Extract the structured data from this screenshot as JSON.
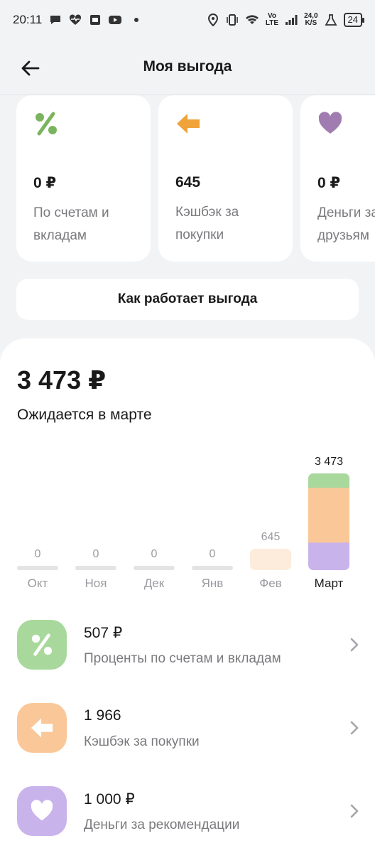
{
  "status_bar": {
    "time": "20:11",
    "net_speed_value": "24,0",
    "net_speed_unit": "K/S",
    "net_type_top": "Vo",
    "net_type_bottom": "LTE",
    "battery": "24"
  },
  "header": {
    "title": "Моя выгода"
  },
  "cards": [
    {
      "icon": "percent-icon",
      "value": "0 ₽",
      "label": "По счетам и\nвкладам",
      "color": "#7BB45E"
    },
    {
      "icon": "arrow-left-icon",
      "value": "645",
      "label": "Кэшбэк за\nпокупки",
      "color": "#F0A33A"
    },
    {
      "icon": "heart-icon",
      "value": "0 ₽",
      "label": "Деньги за\nдрузьям",
      "color": "#A07CB0"
    }
  ],
  "how_button": "Как работает выгода",
  "summary": {
    "total": "3 473 ₽",
    "subtitle": "Ожидается в марте"
  },
  "chart_data": {
    "type": "bar",
    "stacked": true,
    "categories": [
      "Окт",
      "Ноя",
      "Дек",
      "Янв",
      "Фев",
      "Март"
    ],
    "value_labels": [
      "0",
      "0",
      "0",
      "0",
      "645",
      "3 473"
    ],
    "series": [
      {
        "values": [
          0,
          0,
          0,
          0,
          0,
          1000
        ],
        "color": "#C9B3EB"
      },
      {
        "values": [
          0,
          0,
          0,
          0,
          645,
          1966
        ],
        "color": "#FAC898"
      },
      {
        "values": [
          0,
          0,
          0,
          0,
          0,
          507
        ],
        "color": "#A9D89C"
      }
    ],
    "selected_index": 5,
    "ylim": [
      0,
      3473
    ]
  },
  "rows": [
    {
      "amount": "507 ₽",
      "desc": "Проценты по счетам и вкладам",
      "icon": "percent-icon",
      "color": "#A9D89C"
    },
    {
      "amount": "1 966",
      "desc": "Кэшбэк за покупки",
      "icon": "arrow-left-icon",
      "color": "#FAC898"
    },
    {
      "amount": "1 000 ₽",
      "desc": "Деньги за рекомендации",
      "icon": "heart-icon",
      "color": "#C9B3EB"
    }
  ]
}
